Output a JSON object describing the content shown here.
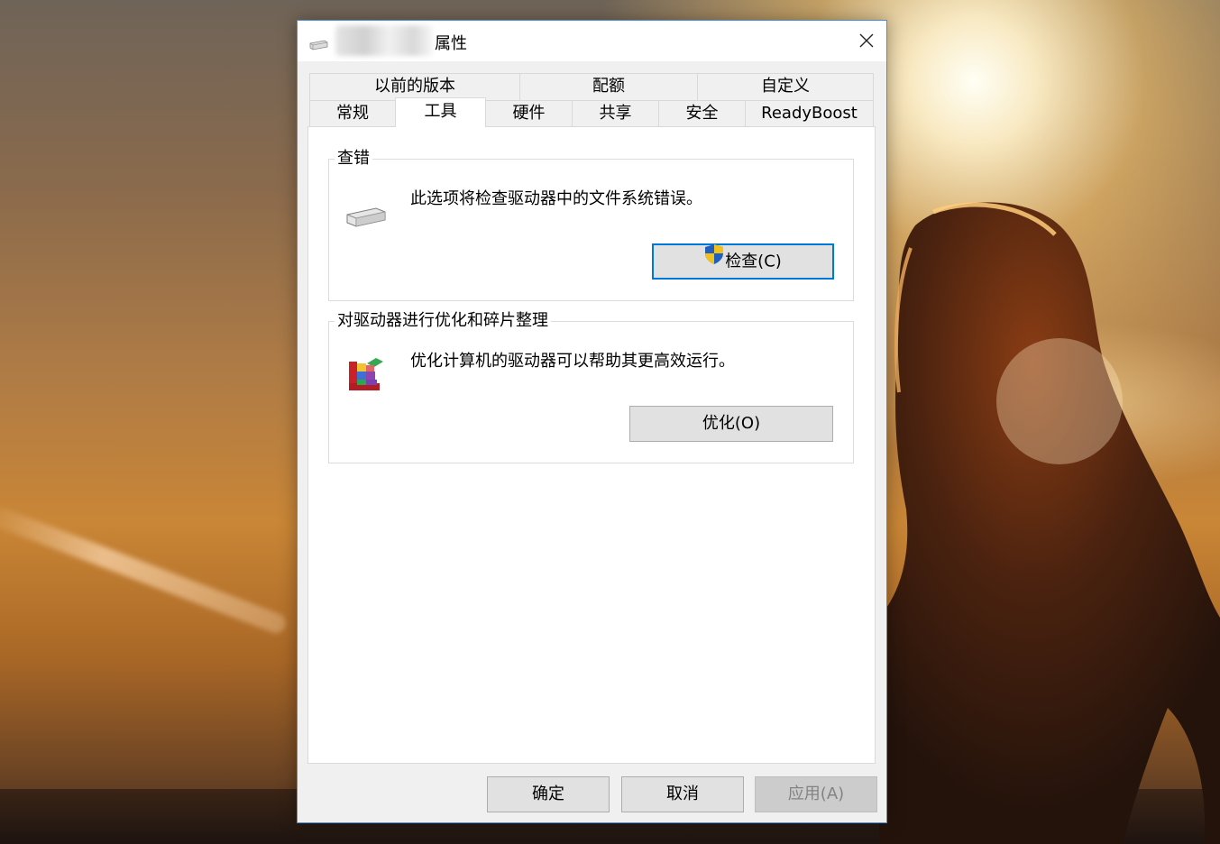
{
  "window": {
    "title": "属性",
    "tabs_row_back": [
      {
        "label": "以前的版本"
      },
      {
        "label": "配额"
      },
      {
        "label": "自定义"
      }
    ],
    "tabs_row_front": [
      {
        "label": "常规"
      },
      {
        "label": "工具"
      },
      {
        "label": "硬件"
      },
      {
        "label": "共享"
      },
      {
        "label": "安全"
      },
      {
        "label": "ReadyBoost"
      }
    ],
    "active_tab": "工具"
  },
  "error_check": {
    "title": "查错",
    "description": "此选项将检查驱动器中的文件系统错误。",
    "button_label": "检查(C)",
    "icon": "drive-icon"
  },
  "optimize": {
    "title": "对驱动器进行优化和碎片整理",
    "description": "优化计算机的驱动器可以帮助其更高效运行。",
    "button_label": "优化(O)",
    "icon": "defrag-icon"
  },
  "footer": {
    "ok_label": "确定",
    "cancel_label": "取消",
    "apply_label": "应用(A)"
  },
  "colors": {
    "focus_border": "#0078d7",
    "window_border": "#4a90d9",
    "dialog_bg": "#f0f0f0"
  }
}
